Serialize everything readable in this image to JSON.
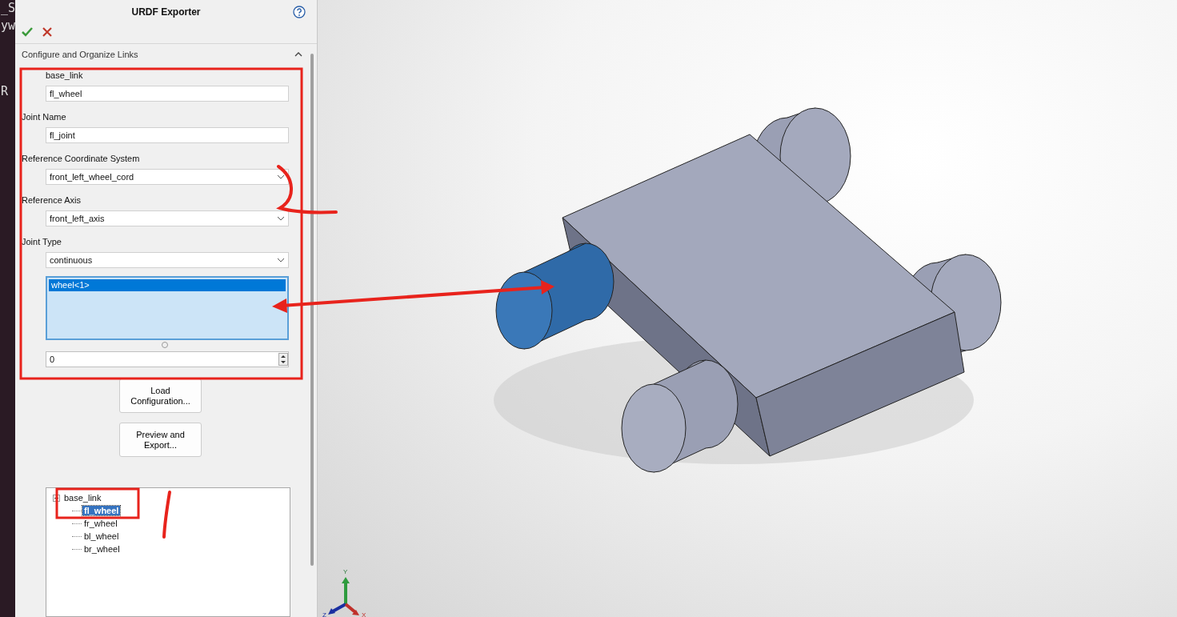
{
  "terminal_fragments": [
    "_S",
    "yw",
    "R"
  ],
  "panel": {
    "title": "URDF Exporter",
    "section": {
      "title": "Configure and Organize Links",
      "expanded": true
    },
    "parent_link": "base_link",
    "link_name": "fl_wheel",
    "fields": [
      {
        "kind": "text",
        "label": "Joint Name",
        "value": "fl_joint"
      },
      {
        "kind": "select",
        "label": "Reference Coordinate System",
        "value": "front_left_wheel_cord"
      },
      {
        "kind": "select",
        "label": "Reference Axis",
        "value": "front_left_axis"
      },
      {
        "kind": "select",
        "label": "Joint Type",
        "value": "continuous"
      }
    ],
    "components": [
      {
        "label": "wheel<1>",
        "selected": true
      }
    ],
    "count": "0",
    "buttons": [
      "Load Configuration...",
      "Preview and Export..."
    ],
    "tree": [
      {
        "label": "base_link",
        "expanded": true,
        "selected": false,
        "children": [
          {
            "label": "fl_wheel",
            "selected": true
          },
          {
            "label": "fr_wheel",
            "selected": false
          },
          {
            "label": "bl_wheel",
            "selected": false
          },
          {
            "label": "br_wheel",
            "selected": false
          }
        ]
      }
    ]
  },
  "axes": [
    "Y",
    "Z",
    "X"
  ]
}
